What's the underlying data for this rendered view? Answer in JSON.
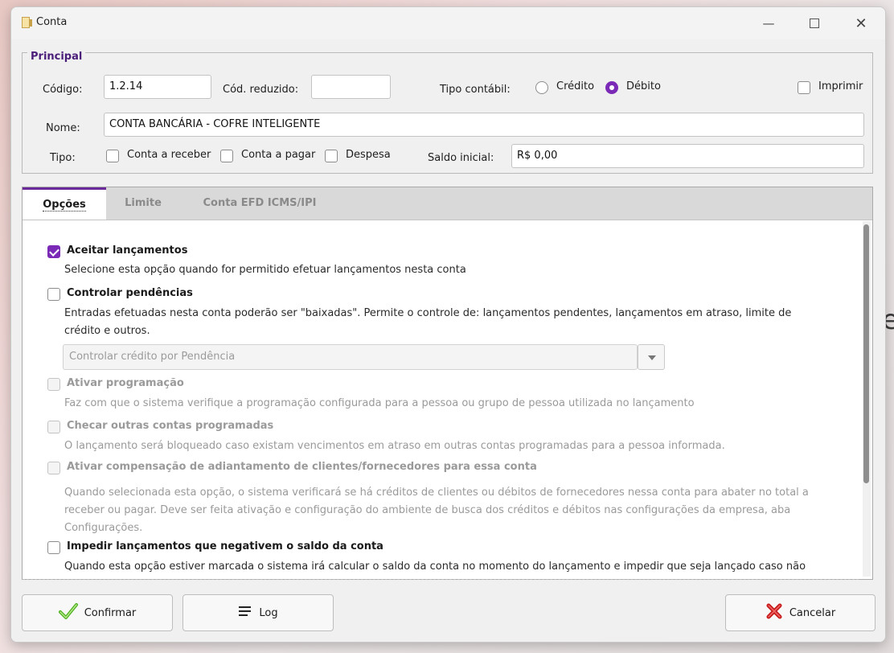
{
  "window": {
    "title": "Conta"
  },
  "principal": {
    "legend": "Principal",
    "codigo_label": "Código:",
    "codigo_value": "1.2.14",
    "cod_reduzido_label": "Cód. reduzido:",
    "cod_reduzido_value": "",
    "tipo_contabil_label": "Tipo contábil:",
    "credito_label": "Crédito",
    "debito_label": "Débito",
    "tipo_contabil_selected": "Débito",
    "imprimir_label": "Imprimir",
    "imprimir_checked": false,
    "nome_label": "Nome:",
    "nome_value": "CONTA BANCÁRIA - COFRE INTELIGENTE",
    "tipo_label": "Tipo:",
    "tipo_options": [
      "Conta a receber",
      "Conta a pagar",
      "Despesa"
    ],
    "saldo_inicial_label": "Saldo inicial:",
    "saldo_inicial_value": "R$ 0,00"
  },
  "tabs": [
    {
      "label": "Opções",
      "active": true
    },
    {
      "label": "Limite",
      "active": false
    },
    {
      "label": "Conta EFD ICMS/IPI",
      "active": false
    }
  ],
  "options": {
    "aceitar": {
      "title": "Aceitar lançamentos",
      "checked": true,
      "desc": "Selecione esta opção quando for permitido efetuar lançamentos nesta conta"
    },
    "controlar": {
      "title": "Controlar pendências",
      "checked": false,
      "desc": "Entradas efetuadas nesta conta poderão ser \"baixadas\". Permite o controle de: lançamentos pendentes, lançamentos em atraso, limite de crédito e outros.",
      "combo_value": "Controlar crédito por Pendência"
    },
    "programacao": {
      "title": "Ativar programação",
      "checked": false,
      "enabled": false,
      "desc": "Faz com que o sistema verifique a programação configurada para a pessoa ou grupo de pessoa utilizada no lançamento"
    },
    "checar": {
      "title": "Checar outras contas programadas",
      "checked": false,
      "enabled": false,
      "desc": "O lançamento será bloqueado caso existam vencimentos em atraso em outras contas programadas para a pessoa informada."
    },
    "compensacao": {
      "title": "Ativar compensação de adiantamento de clientes/fornecedores para essa conta",
      "checked": false,
      "enabled": false,
      "desc": "Quando  selecionada esta opção, o sistema verificará se há créditos de clientes ou débitos de fornecedores nessa conta para abater no total a receber ou pagar. Deve ser feita ativação e configuração do ambiente de busca dos créditos e débitos nas configurações da empresa, aba Configurações."
    },
    "impedir": {
      "title": "Impedir lançamentos que negativem o saldo da conta",
      "checked": false,
      "desc": "Quando esta opção estiver marcada o sistema irá calcular o saldo da conta no momento do lançamento e impedir que seja lançado caso não"
    }
  },
  "buttons": {
    "confirmar": "Confirmar",
    "log": "Log",
    "cancelar": "Cancelar"
  },
  "colors": {
    "accent": "#7b2ab7",
    "legend": "#4b1e7a"
  },
  "background_glyph": "e"
}
